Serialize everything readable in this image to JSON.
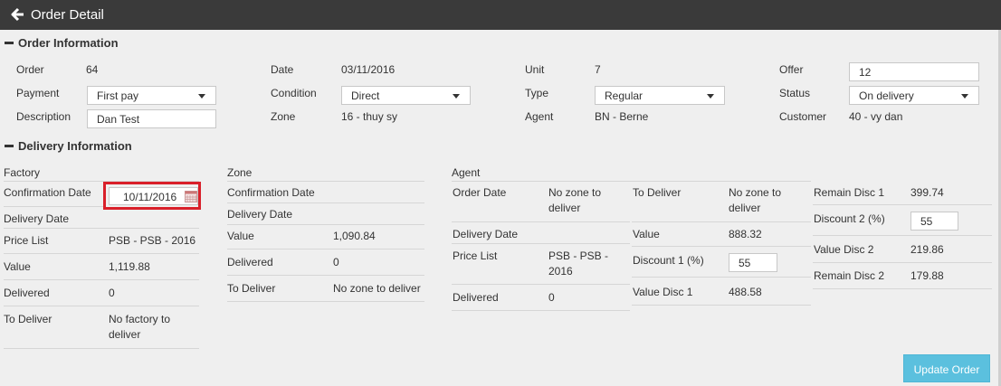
{
  "header": {
    "title": "Order Detail",
    "back_icon": "arrow-left-icon"
  },
  "order_info": {
    "title": "Order Information",
    "order_label": "Order",
    "order_value": "64",
    "payment_label": "Payment",
    "payment_value": "First pay",
    "description_label": "Description",
    "description_value": "Dan Test",
    "date_label": "Date",
    "date_value": "03/11/2016",
    "condition_label": "Condition",
    "condition_value": "Direct",
    "zone_label": "Zone",
    "zone_value": "16 - thuy sy",
    "unit_label": "Unit",
    "unit_value": "7",
    "type_label": "Type",
    "type_value": "Regular",
    "agent_label": "Agent",
    "agent_value": "BN - Berne",
    "offer_label": "Offer",
    "offer_value": "12",
    "status_label": "Status",
    "status_value": "On delivery",
    "customer_label": "Customer",
    "customer_value": "40 - vy dan"
  },
  "delivery_info": {
    "title": "Delivery Information",
    "factory": {
      "title": "Factory",
      "confirmation_date_label": "Confirmation Date",
      "confirmation_date_value": "10/11/2016",
      "delivery_date_label": "Delivery Date",
      "price_list_label": "Price List",
      "price_list_value": "PSB - PSB - 2016",
      "value_label": "Value",
      "value_value": "1,119.88",
      "delivered_label": "Delivered",
      "delivered_value": "0",
      "to_deliver_label": "To Deliver",
      "to_deliver_value_1": "No factory to",
      "to_deliver_value_2": "deliver"
    },
    "zone": {
      "title": "Zone",
      "confirmation_date_label": "Confirmation Date",
      "delivery_date_label": "Delivery Date",
      "value_label": "Value",
      "value_value": "1,090.84",
      "delivered_label": "Delivered",
      "delivered_value": "0",
      "to_deliver_label": "To Deliver",
      "to_deliver_value": "No zone to deliver"
    },
    "agent": {
      "title": "Agent",
      "order_date_label": "Order Date",
      "order_date_value_1": "No zone to",
      "order_date_value_2": "deliver",
      "delivery_date_label": "Delivery Date",
      "price_list_label": "Price List",
      "price_list_value_1": "PSB - PSB -",
      "price_list_value_2": "2016",
      "delivered_label": "Delivered",
      "delivered_value": "0",
      "to_deliver_label": "To Deliver",
      "to_deliver_value_1": "No zone to",
      "to_deliver_value_2": "deliver",
      "value_label": "Value",
      "value_value": "888.32",
      "discount1_label": "Discount 1 (%)",
      "discount1_value": "55",
      "value_disc1_label": "Value Disc 1",
      "value_disc1_value": "488.58",
      "remain_disc1_label": "Remain Disc 1",
      "remain_disc1_value": "399.74",
      "discount2_label": "Discount 2 (%)",
      "discount2_value": "55",
      "value_disc2_label": "Value Disc 2",
      "value_disc2_value": "219.86",
      "remain_disc2_label": "Remain Disc 2",
      "remain_disc2_value": "179.88"
    }
  },
  "actions": {
    "update_label": "Update Order"
  },
  "colors": {
    "header_bg": "#3a3a3a",
    "button_bg": "#5bc0de",
    "highlight": "#d9202a"
  }
}
